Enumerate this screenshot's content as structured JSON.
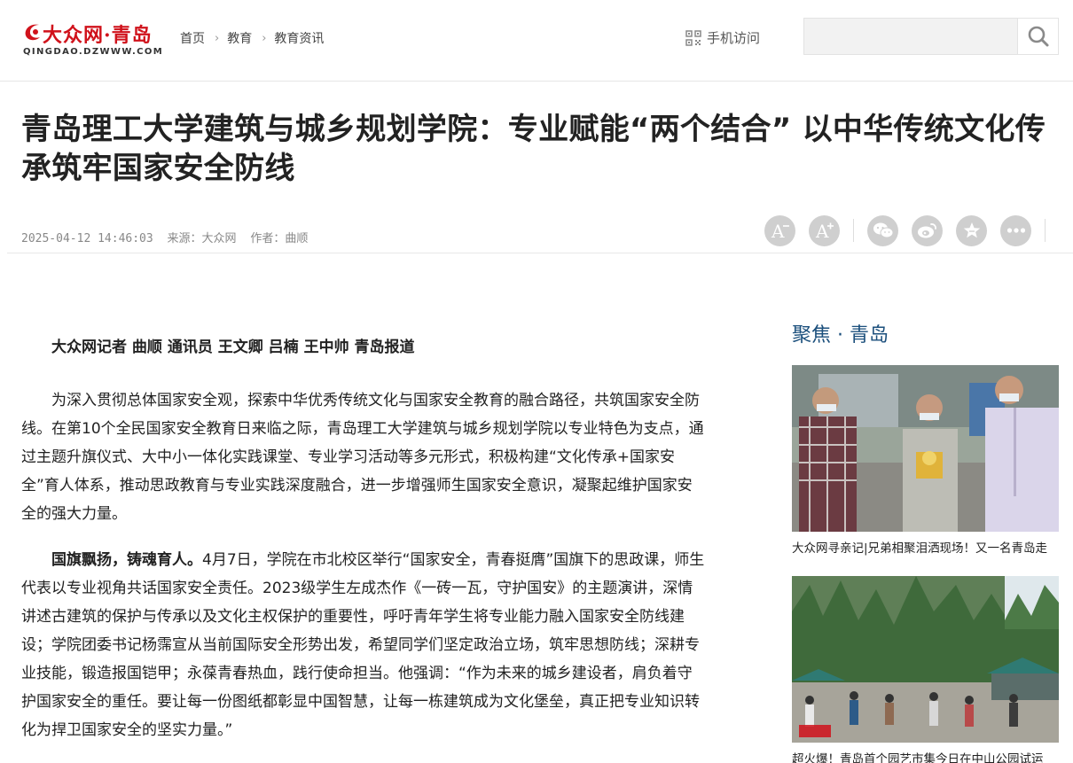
{
  "header": {
    "logo_text": "大众网·青岛",
    "logo_domain": "QINGDAO.DZWWW.COM",
    "breadcrumb": [
      "首页",
      "教育",
      "教育资讯"
    ],
    "mobile_label": "手机访问",
    "search_placeholder": ""
  },
  "article": {
    "title": "青岛理工大学建筑与城乡规划学院：专业赋能“两个结合” 以中华传统文化传承筑牢国家安全防线",
    "datetime": "2025-04-12 14:46:03",
    "source": "来源：大众网",
    "author": "作者：曲顺",
    "byline": "大众网记者 曲顺 通讯员 王文卿 吕楠 王中帅 青岛报道",
    "para1": "为深入贯彻总体国家安全观，探索中华优秀传统文化与国家安全教育的融合路径，共筑国家安全防线。在第10个全民国家安全教育日来临之际，青岛理工大学建筑与城乡规划学院以专业特色为支点，通过主题升旗仪式、大中小一体化实践课堂、专业学习活动等多元形式，积极构建“文化传承+国家安全”育人体系，推动思政教育与专业实践深度融合，进一步增强师生国家安全意识，凝聚起维护国家安全的强大力量。",
    "para2_lead": "国旗飘扬，铸魂育人。",
    "para2": "4月7日，学院在市北校区举行“国家安全，青春挺膺”国旗下的思政课，师生代表以专业视角共话国家安全责任。2023级学生左成杰作《一砖一瓦，守护国安》的主题演讲，深情讲述古建筑的保护与传承以及文化主权保护的重要性，呼吁青年学生将专业能力融入国家安全防线建设；学院团委书记杨霈宣从当前国际安全形势出发，希望同学们坚定政治立场，筑牢思想防线；深耕专业技能，锻造报国铠甲；永葆青春热血，践行使命担当。他强调：“作为未来的城乡建设者，肩负着守护国家安全的重任。要让每一份图纸都彰显中国智慧，让每一栋建筑成为文化堡垒，真正把专业知识转化为捍卫国家安全的坚实力量。”"
  },
  "tools": {
    "font_smaller": "A",
    "font_larger": "A",
    "icons": [
      "font-decrease-icon",
      "font-increase-icon",
      "wechat-icon",
      "weibo-icon",
      "favorite-icon",
      "more-icon"
    ]
  },
  "sidebar": {
    "title": "聚焦 · 青岛",
    "items": [
      {
        "caption": "大众网寻亲记|兄弟相聚泪洒现场！又一名青岛走"
      },
      {
        "caption": "超火爆！青岛首个园艺市集今日在中山公园试运"
      }
    ]
  },
  "colors": {
    "brand_red": "#d0121b",
    "sidebar_title": "#1b4f7c",
    "tool_circle": "#cfcfcf"
  }
}
